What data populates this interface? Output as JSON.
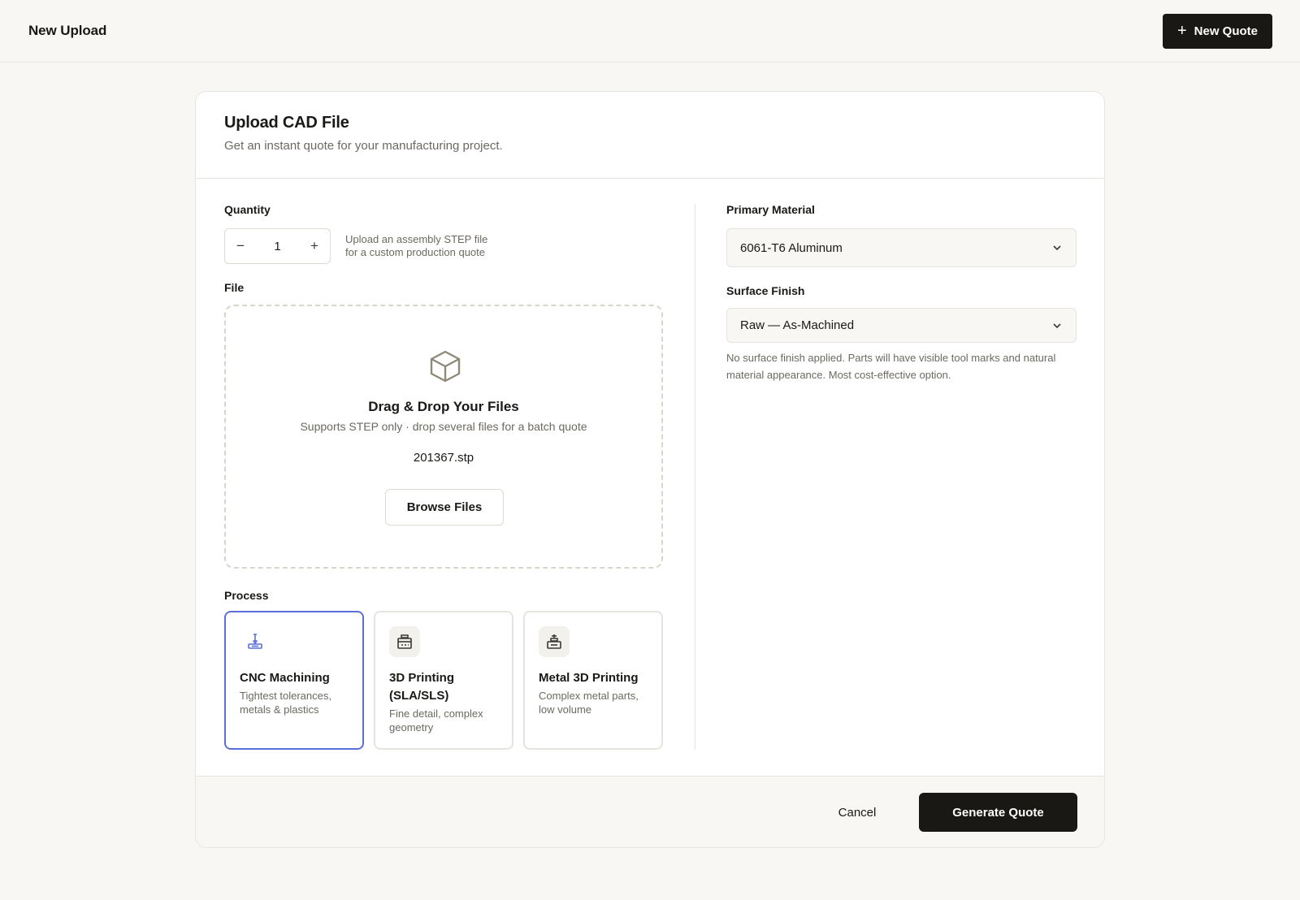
{
  "header": {
    "title": "New Upload",
    "new_quote_label": "New Quote"
  },
  "card": {
    "title": "Upload CAD File",
    "subtitle": "Get an instant quote for your manufacturing project."
  },
  "quantity": {
    "label": "Quantity",
    "value": "1",
    "decrement": "−",
    "increment": "+",
    "help_line1": "Upload an assembly STEP file",
    "help_line2": "for a custom production quote"
  },
  "file": {
    "label": "File",
    "title": "Drag & Drop Your Files",
    "subtitle": "Supports STEP only · drop several files for a batch quote",
    "filename": "201367.stp",
    "browse_label": "Browse Files",
    "icon": "cube-icon"
  },
  "process": {
    "label": "Process",
    "selected": "CNC Machining",
    "options": [
      {
        "title": "CNC Machining",
        "desc": "Tightest tolerances, metals & plastics",
        "icon": "cnc-mill-icon"
      },
      {
        "title": "3D Printing (SLA/SLS)",
        "desc": "Fine detail, complex geometry",
        "icon": "3d-printer-icon"
      },
      {
        "title": "Metal 3D Printing",
        "desc": "Complex metal parts, low volume",
        "icon": "metal-printer-icon"
      }
    ]
  },
  "material": {
    "label": "Primary Material",
    "value": "6061-T6 Aluminum"
  },
  "finish": {
    "label": "Surface Finish",
    "value": "Raw — As-Machined",
    "help": "No surface finish applied. Parts will have visible tool marks and natural material appearance. Most cost-effective option."
  },
  "footer": {
    "cancel_label": "Cancel",
    "generate_label": "Generate Quote"
  },
  "colors": {
    "primary_button": "#191815",
    "selected_border": "#5b6fd9",
    "background": "#f8f7f4"
  }
}
